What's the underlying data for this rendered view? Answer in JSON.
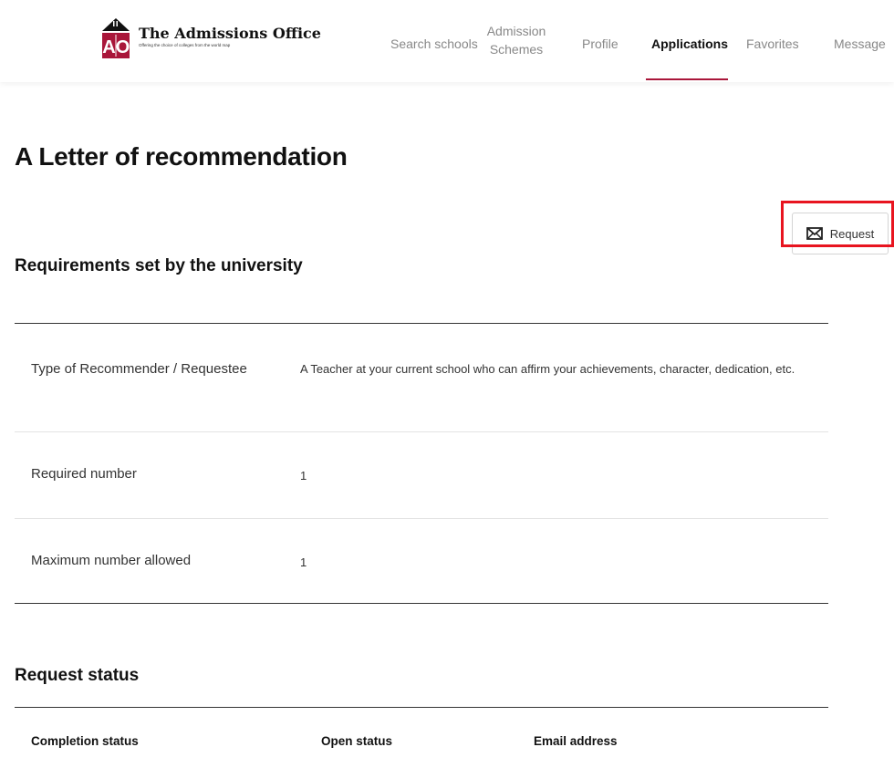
{
  "header": {
    "logo": {
      "title": "The Admissions Office",
      "tagline": "Offering the choice of colleges from the world map",
      "mark_letters": "AO"
    },
    "nav": [
      {
        "label": "Search schools",
        "active": false
      },
      {
        "label": "Admission Schemes",
        "active": false
      },
      {
        "label": "Profile",
        "active": false
      },
      {
        "label": "Applications",
        "active": true
      },
      {
        "label": "Favorites",
        "active": false
      },
      {
        "label": "Message",
        "active": false
      }
    ]
  },
  "main": {
    "title": "A Letter of recommendation",
    "request_button": {
      "label": "Request",
      "icon": "envelope-icon"
    },
    "requirements": {
      "title": "Requirements set by the university",
      "rows": [
        {
          "label": "Type of Recommender / Requestee",
          "value": "A Teacher at your current school who can affirm your achievements, character, dedication, etc."
        },
        {
          "label": "Required number",
          "value": "1"
        },
        {
          "label": "Maximum number allowed",
          "value": "1"
        }
      ]
    },
    "request_status": {
      "title": "Request status",
      "columns": [
        "Completion status",
        "Open status",
        "Email address"
      ]
    }
  },
  "colors": {
    "accent": "#a9163a",
    "highlight": "#e8141f"
  }
}
